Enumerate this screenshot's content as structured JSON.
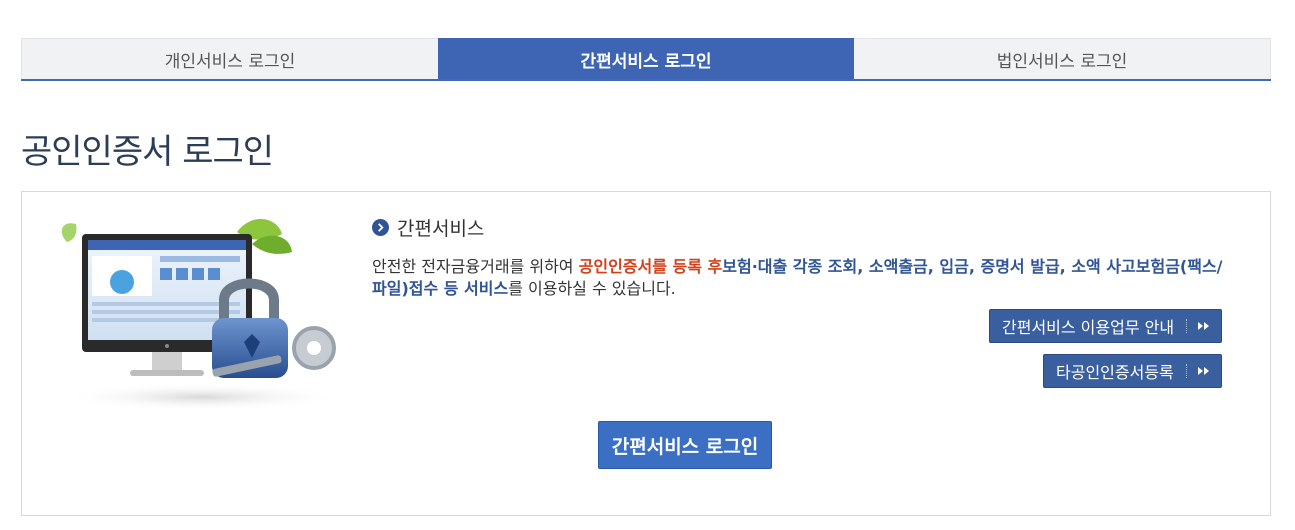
{
  "tabs": [
    {
      "label": "개인서비스 로그인",
      "active": false
    },
    {
      "label": "간편서비스 로그인",
      "active": true
    },
    {
      "label": "법인서비스 로그인",
      "active": false
    }
  ],
  "page_title": "공인인증서 로그인",
  "panel": {
    "section_title": "간편서비스",
    "desc_part1": "안전한 전자금융거래를 위하여 ",
    "desc_red": "공인인증서를 등록 후",
    "desc_blue": "보험·대출 각종 조회, 소액출금, 입금, 증명서 발급, 소액 사고보험금(팩스/파일)접수 등 서비스",
    "desc_part2": "를 이용하실 수 있습니다.",
    "guide_button": "간편서비스 이용업무 안내",
    "register_button": "타공인인증서등록",
    "login_button": "간편서비스 로그인"
  },
  "colors": {
    "tab_active": "#3d65b4",
    "highlight_red": "#d2401a",
    "highlight_blue": "#2f5596",
    "button_blue": "#3a6fc4"
  },
  "icons": [
    "chevron-circle-right-icon",
    "double-arrow-right-icon",
    "padlock-monitor-illustration"
  ]
}
